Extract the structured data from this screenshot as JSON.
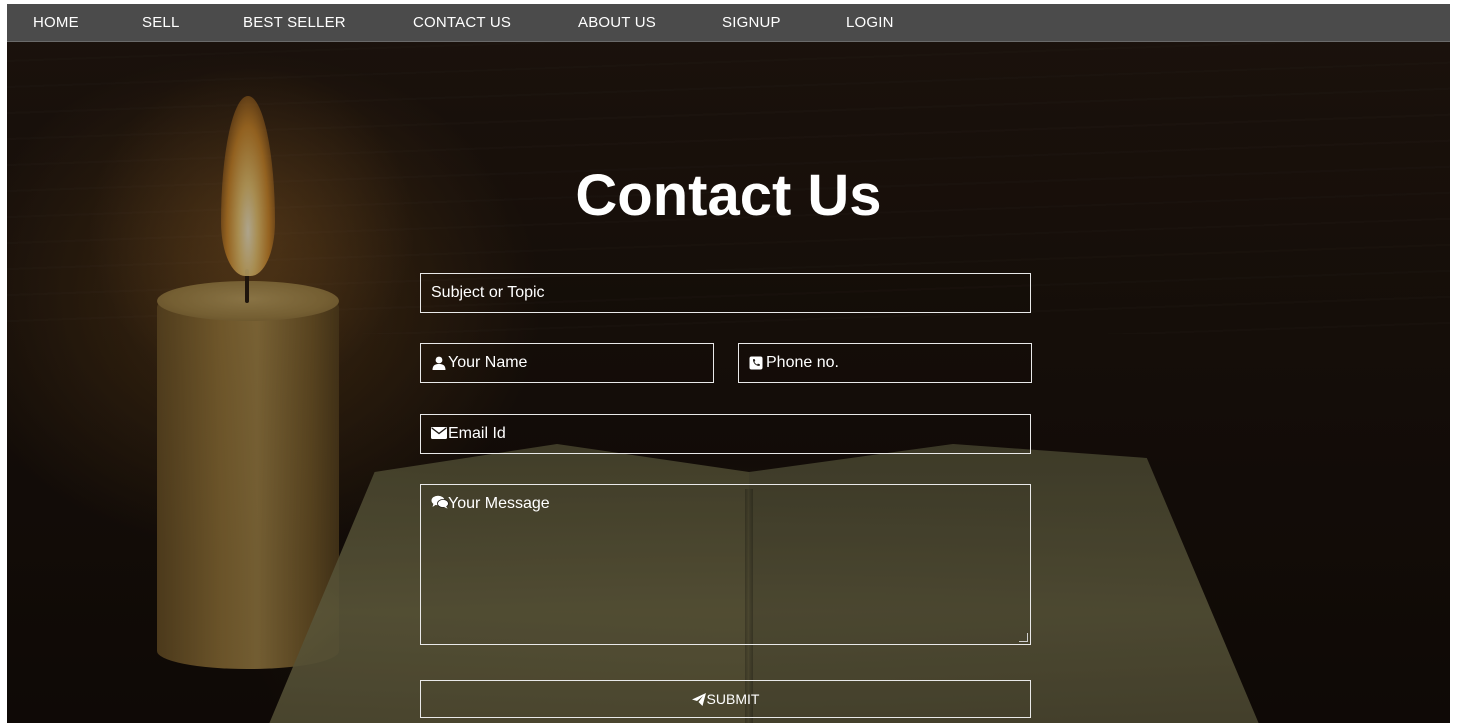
{
  "nav": {
    "items": [
      {
        "label": "HOME"
      },
      {
        "label": "SELL"
      },
      {
        "label": "BEST SELLER"
      },
      {
        "label": "CONTACT US"
      },
      {
        "label": "ABOUT US"
      },
      {
        "label": "SIGNUP"
      },
      {
        "label": "LOGIN"
      }
    ]
  },
  "page": {
    "title": "Contact Us"
  },
  "form": {
    "subject_placeholder": "Subject or Topic",
    "name_placeholder": "Your Name",
    "phone_placeholder": "Phone no.",
    "email_placeholder": "Email Id",
    "message_placeholder": "Your Message",
    "submit_label": "SUBMIT"
  },
  "icons": {
    "name": "user-icon",
    "phone": "phone-icon",
    "email": "envelope-icon",
    "message": "comments-icon",
    "submit": "paper-plane-icon"
  },
  "colors": {
    "navbar_bg": "#4b4b4b",
    "text": "#ffffff",
    "field_border": "#e9e9e9"
  }
}
